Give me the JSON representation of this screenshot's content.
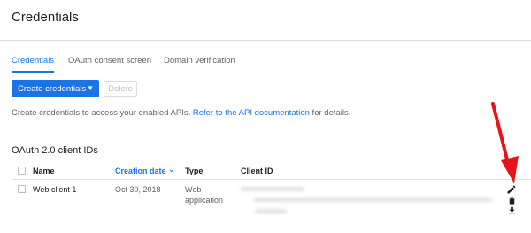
{
  "header": {
    "title": "Credentials"
  },
  "tabs": [
    {
      "label": "Credentials",
      "active": true
    },
    {
      "label": "OAuth consent screen",
      "active": false
    },
    {
      "label": "Domain verification",
      "active": false
    }
  ],
  "toolbar": {
    "create_label": "Create credentials",
    "create_caret": "▼",
    "delete_label": "Delete"
  },
  "info": {
    "text_before": "Create credentials to access your enabled APIs. ",
    "link_text": "Refer to the API documentation",
    "text_after": " for details."
  },
  "section": {
    "title": "OAuth 2.0 client IDs"
  },
  "table": {
    "columns": {
      "name": "Name",
      "creation_date": "Creation date",
      "sort_arrow": "⌄",
      "type": "Type",
      "client_id": "Client ID"
    },
    "rows": [
      {
        "name": "Web client 1",
        "creation_date": "Oct 30, 2018",
        "type_line1": "Web",
        "type_line2": "application"
      }
    ]
  },
  "row_actions": [
    "edit-icon",
    "delete-icon",
    "download-icon"
  ],
  "annotation": {
    "arrow_color": "#e8141b"
  },
  "colors": {
    "accent": "#1a73e8",
    "arrow": "#e8141b"
  }
}
